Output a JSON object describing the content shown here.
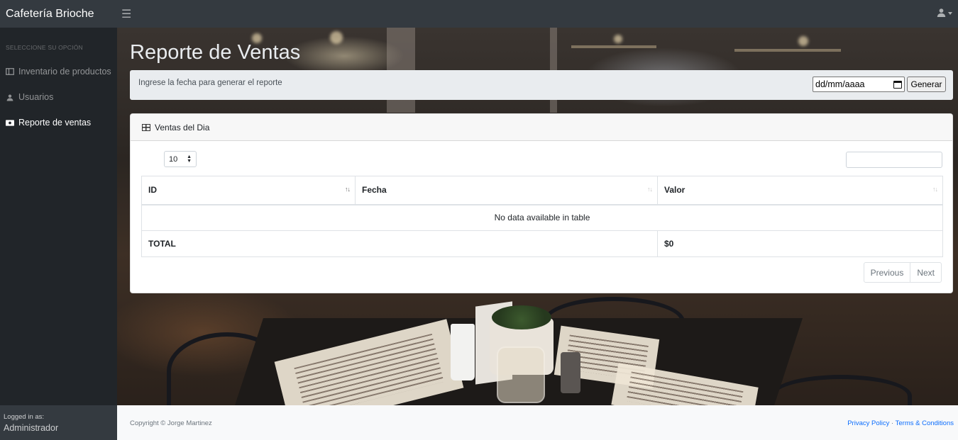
{
  "app": {
    "brand": "Cafetería Brioche"
  },
  "sidebar": {
    "heading": "SELECCIONE SU OPCIÓN",
    "items": [
      {
        "label": "Inventario de productos",
        "icon": "columns-icon"
      },
      {
        "label": "Usuarios",
        "icon": "user-icon"
      },
      {
        "label": "Reporte de ventas",
        "icon": "money-icon",
        "active": true
      }
    ],
    "footer": {
      "logged_label": "Logged in as:",
      "user": "Administrador"
    }
  },
  "page": {
    "title": "Reporte de Ventas",
    "date_hint": "Ingrese la fecha para generar el reporte",
    "date_value": "dd/mm/aaaa",
    "generate_label": "Generar"
  },
  "card": {
    "title": "Ventas del Dia",
    "page_length": "10",
    "search_value": "",
    "columns": [
      "ID",
      "Fecha",
      "Valor"
    ],
    "empty_message": "No data available in table",
    "total_label": "TOTAL",
    "total_value": "$0",
    "pagination": {
      "previous": "Previous",
      "next": "Next"
    }
  },
  "footer": {
    "copyright": "Copyright © Jorge Martinez",
    "privacy": "Privacy Policy",
    "separator": "·",
    "terms": "Terms & Conditions"
  },
  "colors": {
    "navbar": "#343a40",
    "sidebar": "#212529",
    "link": "#0d6efd"
  }
}
